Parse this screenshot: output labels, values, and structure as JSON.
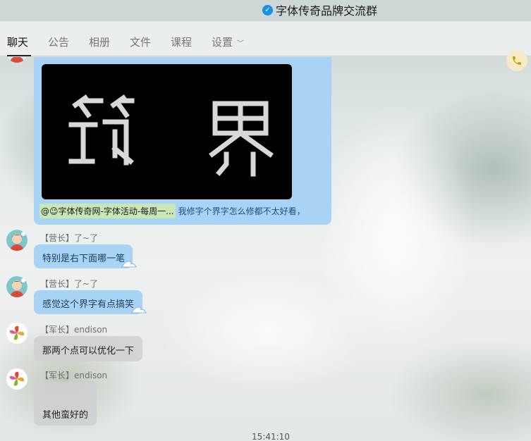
{
  "window": {
    "title": "字体传奇品牌交流群",
    "verified_icon": "verified-check-icon"
  },
  "tabs": [
    {
      "label": "聊天",
      "active": true
    },
    {
      "label": "公告",
      "active": false
    },
    {
      "label": "相册",
      "active": false
    },
    {
      "label": "文件",
      "active": false
    },
    {
      "label": "课程",
      "active": false
    },
    {
      "label": "设置",
      "active": false,
      "has_dropdown": true
    }
  ],
  "header": {
    "call_icon": "phone-icon",
    "call_color": "#c9a400"
  },
  "messages": [
    {
      "type": "image",
      "image_glyphs": [
        "筑",
        "界"
      ],
      "mention": "@😉字体传奇网-字体活动-每周一...",
      "text": "我修字个界字怎么修都不太好看，"
    },
    {
      "role": "【营长】",
      "name": "了~了",
      "text": "特别是右下面哪一笔",
      "bubble": "blue"
    },
    {
      "role": "【营长】",
      "name": "了~了",
      "text": "感觉这个界字有点搞笑",
      "bubble": "blue"
    },
    {
      "role": "【军长】",
      "name": "endison",
      "text": "那两个点可以优化一下",
      "bubble": "gray"
    },
    {
      "role": "【军长】",
      "name": "endison",
      "text": "其他蛮好的",
      "bubble": "gray"
    }
  ],
  "timestamp": "15:41:10",
  "colors": {
    "bubble_blue": "#a9d3f4",
    "bubble_gray": "#cfd1d1",
    "mention_highlight": "#c8e7b5",
    "verified": "#1a8fe3"
  }
}
